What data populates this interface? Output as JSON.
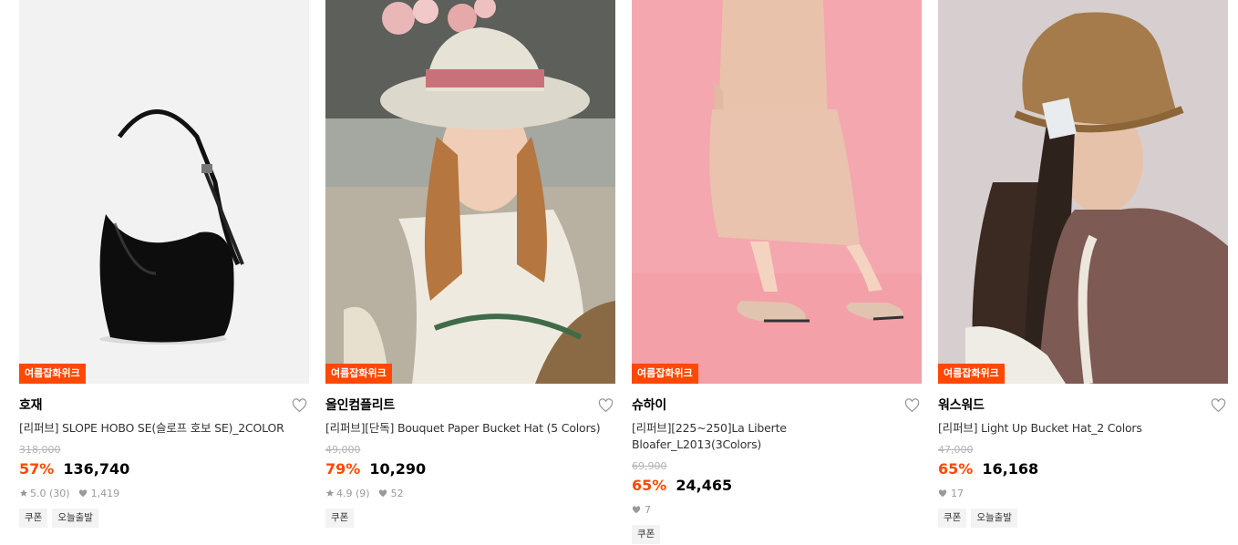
{
  "products": [
    {
      "badge": "여름잡화위크",
      "brand": "호재",
      "name": "[리퍼브] SLOPE HOBO SE(슬로프 호보 SE)_2COLOR",
      "original_price": "318,000",
      "discount": "57%",
      "price": "136,740",
      "rating": "5.0",
      "reviews": "(30)",
      "likes": "1,419",
      "tags": [
        "쿠폰",
        "오늘출발"
      ],
      "image": "black-hobo-bag",
      "like_icon": "heart-outline-icon"
    },
    {
      "badge": "여름잡화위크",
      "brand": "올인컴플리트",
      "name": "[리퍼브][단독] Bouquet Paper Bucket Hat (5 Colors)",
      "original_price": "49,000",
      "discount": "79%",
      "price": "10,290",
      "rating": "4.9",
      "reviews": "(9)",
      "likes": "52",
      "tags": [
        "쿠폰"
      ],
      "image": "woman-in-paper-bucket-hat",
      "like_icon": "heart-outline-icon"
    },
    {
      "badge": "여름잡화위크",
      "brand": "슈하이",
      "name": "[리퍼브][225~250]La Liberte Bloafer_L2013(3Colors)",
      "original_price": "69,900",
      "discount": "65%",
      "price": "24,465",
      "rating": "",
      "reviews": "",
      "likes": "7",
      "tags": [
        "쿠폰"
      ],
      "image": "beige-loafers-on-pink",
      "like_icon": "heart-outline-icon"
    },
    {
      "badge": "여름잡화위크",
      "brand": "워스워드",
      "name": "[리퍼브] Light Up Bucket Hat_2 Colors",
      "original_price": "47,000",
      "discount": "65%",
      "price": "16,168",
      "rating": "",
      "reviews": "",
      "likes": "17",
      "tags": [
        "쿠폰",
        "오늘출발"
      ],
      "image": "woman-in-straw-bucket-hat",
      "like_icon": "heart-outline-icon"
    }
  ],
  "colors": {
    "accent": "#ff4800",
    "strike": "#b3b3b3",
    "meta": "#999999",
    "tag_bg": "#f3f3f3"
  }
}
